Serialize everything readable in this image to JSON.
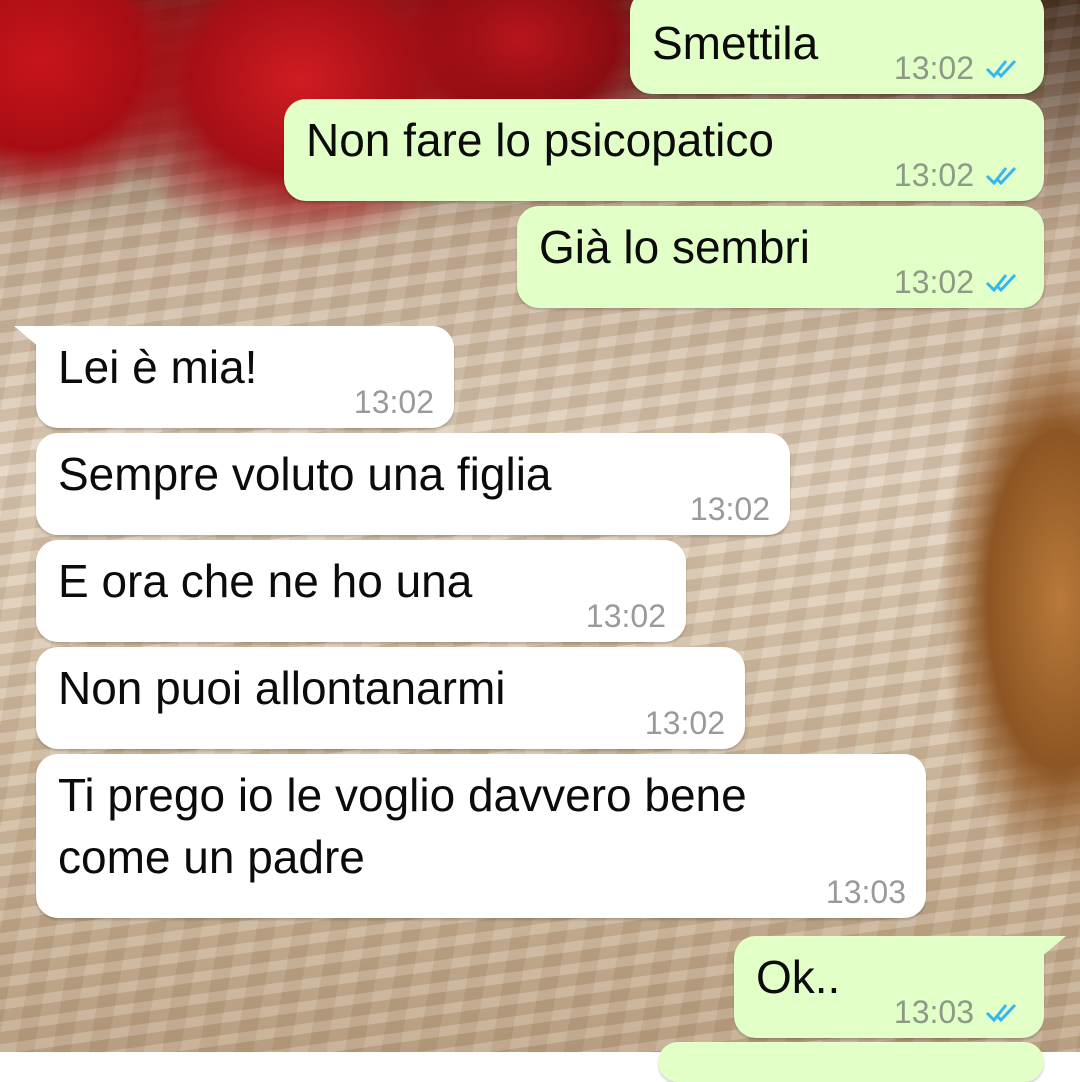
{
  "colors": {
    "outgoing_bubble": "#e2ffc7",
    "incoming_bubble": "#ffffff",
    "read_ticks": "#34b7f1",
    "timestamp": "#8c9a86"
  },
  "messages": [
    {
      "direction": "outgoing",
      "text": "Smettila",
      "time": "13:02",
      "status": "read",
      "status_icon": "double-check-read-icon"
    },
    {
      "direction": "outgoing",
      "text": "Non fare lo psicopatico",
      "time": "13:02",
      "status": "read",
      "status_icon": "double-check-read-icon"
    },
    {
      "direction": "outgoing",
      "text": "Già lo sembri",
      "time": "13:02",
      "status": "read",
      "status_icon": "double-check-read-icon"
    },
    {
      "direction": "incoming",
      "text": "Lei è mia!",
      "time": "13:02"
    },
    {
      "direction": "incoming",
      "text": "Sempre voluto una figlia",
      "time": "13:02"
    },
    {
      "direction": "incoming",
      "text": "E ora che ne ho una",
      "time": "13:02"
    },
    {
      "direction": "incoming",
      "text": "Non puoi allontanarmi",
      "time": "13:02"
    },
    {
      "direction": "incoming",
      "text": "Ti prego io le voglio davvero bene\ncome un padre",
      "time": "13:03"
    },
    {
      "direction": "outgoing",
      "text": "Ok..",
      "time": "13:03",
      "status": "read",
      "status_icon": "double-check-read-icon"
    }
  ]
}
